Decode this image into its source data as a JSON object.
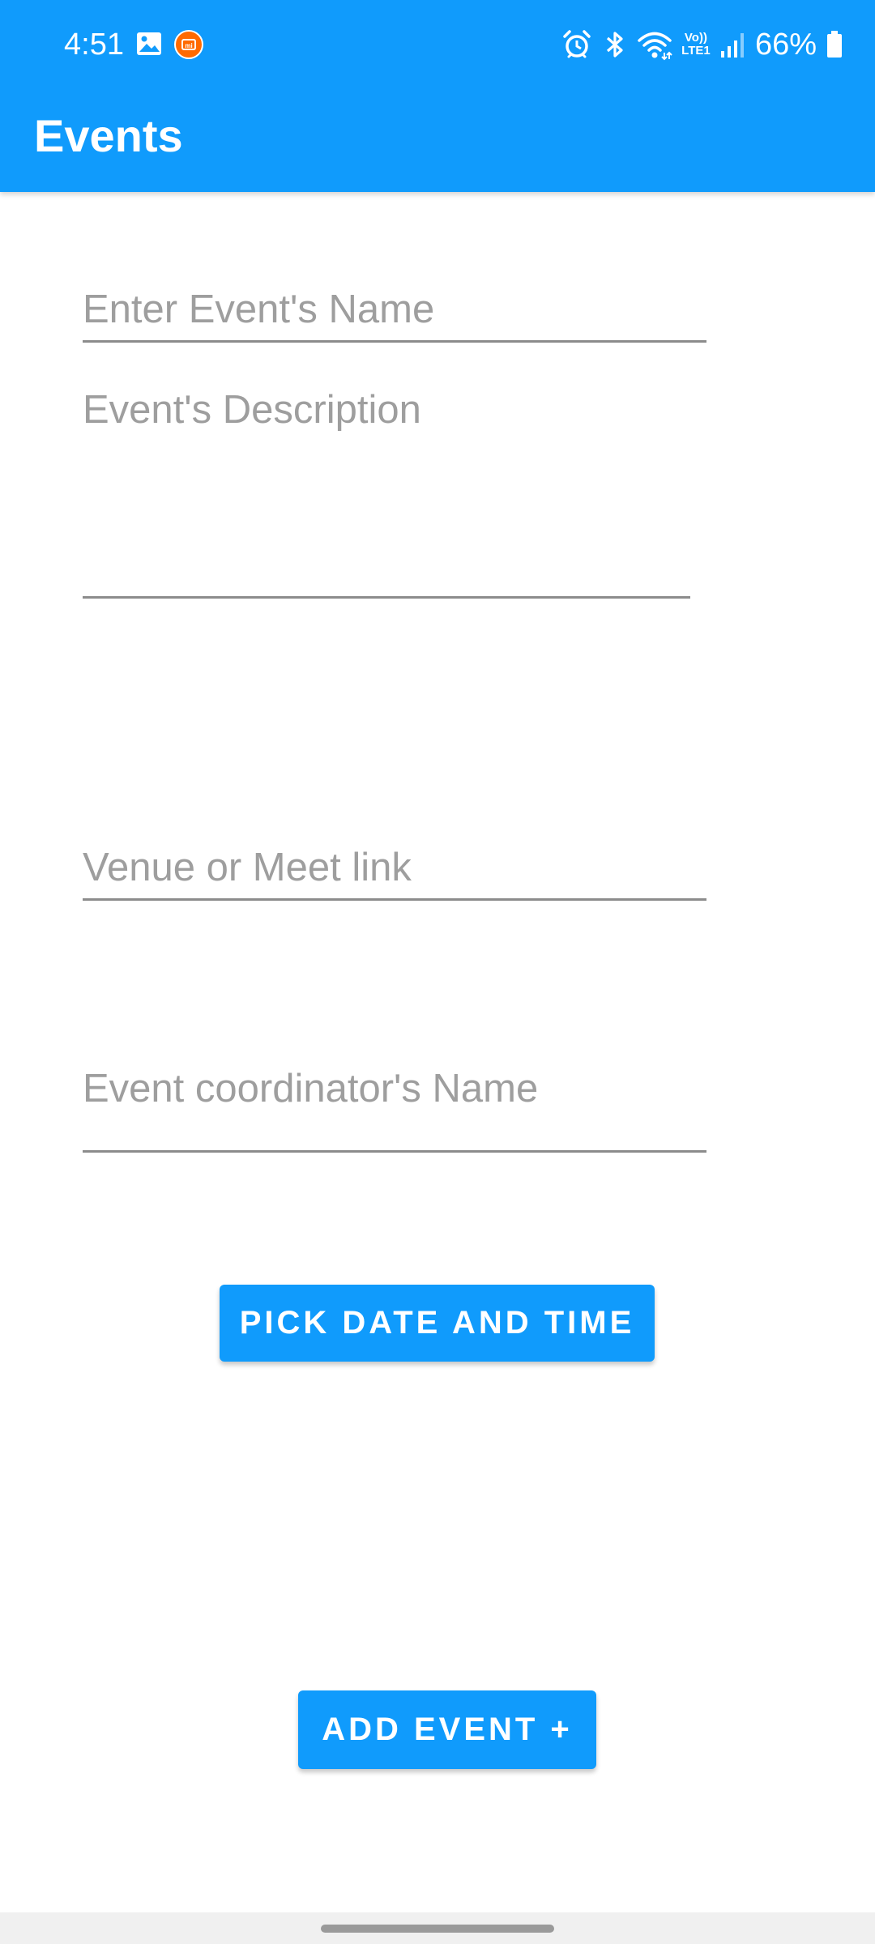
{
  "status_bar": {
    "time": "4:51",
    "network_label": "Vo)) LTE1",
    "battery_percent": "66%",
    "icons": [
      "gallery-icon",
      "mi-app-icon",
      "alarm-icon",
      "bluetooth-icon",
      "wifi-icon",
      "signal-icon",
      "battery-icon"
    ]
  },
  "header": {
    "title": "Events"
  },
  "form": {
    "event_name_placeholder": "Enter Event's Name",
    "description_placeholder": "Event's Description",
    "venue_placeholder": "Venue or Meet link",
    "coordinator_placeholder": "Event coordinator's Name"
  },
  "buttons": {
    "pick_date_time": "PICK DATE AND TIME",
    "add_event": "ADD EVENT +"
  },
  "colors": {
    "primary": "#109bfc",
    "placeholder_text": "#9e9e9e",
    "underline": "#8c8c8c",
    "background": "#ffffff"
  }
}
